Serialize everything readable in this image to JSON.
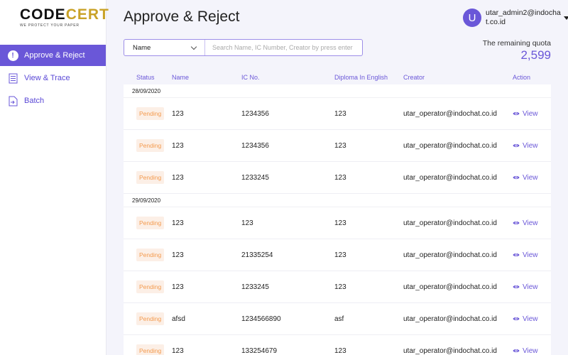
{
  "logo": {
    "code": "CODE",
    "cert": "CERT",
    "tagline": "WE PROTECT YOUR PAPER"
  },
  "sidebar": {
    "items": [
      {
        "label": "Approve & Reject",
        "icon": "alert-icon",
        "active": true
      },
      {
        "label": "View & Trace",
        "icon": "document-icon",
        "active": false
      },
      {
        "label": "Batch",
        "icon": "batch-icon",
        "active": false
      }
    ]
  },
  "header": {
    "title": "Approve & Reject",
    "user": {
      "initial": "U",
      "name": "utar_admin2@indochat.co.id"
    }
  },
  "search": {
    "field": "Name",
    "placeholder": "Search Name, IC Number, Creator by press enter"
  },
  "quota": {
    "label": "The remaining quota",
    "value": "2,599"
  },
  "table": {
    "headers": {
      "status": "Status",
      "name": "Name",
      "ic": "IC No.",
      "diploma": "Diploma In English",
      "creator": "Creator",
      "action": "Action"
    },
    "groups": [
      {
        "date": "28/09/2020",
        "rows": [
          {
            "status": "Pending",
            "name": "123",
            "ic": "1234356",
            "diploma": "123",
            "creator": "utar_operator@indochat.co.id",
            "action": "View"
          },
          {
            "status": "Pending",
            "name": "123",
            "ic": "1234356",
            "diploma": "123",
            "creator": "utar_operator@indochat.co.id",
            "action": "View"
          },
          {
            "status": "Pending",
            "name": "123",
            "ic": "1233245",
            "diploma": "123",
            "creator": "utar_operator@indochat.co.id",
            "action": "View"
          }
        ]
      },
      {
        "date": "29/09/2020",
        "rows": [
          {
            "status": "Pending",
            "name": "123",
            "ic": "123",
            "diploma": "123",
            "creator": "utar_operator@indochat.co.id",
            "action": "View"
          },
          {
            "status": "Pending",
            "name": "123",
            "ic": "21335254",
            "diploma": "123",
            "creator": "utar_operator@indochat.co.id",
            "action": "View"
          },
          {
            "status": "Pending",
            "name": "123",
            "ic": "1233245",
            "diploma": "123",
            "creator": "utar_operator@indochat.co.id",
            "action": "View"
          },
          {
            "status": "Pending",
            "name": "afsd",
            "ic": "1234566890",
            "diploma": "asf",
            "creator": "utar_operator@indochat.co.id",
            "action": "View"
          },
          {
            "status": "Pending",
            "name": "123",
            "ic": "133254679",
            "diploma": "123",
            "creator": "utar_operator@indochat.co.id",
            "action": "View"
          }
        ]
      }
    ]
  },
  "colors": {
    "accent": "#6a57d8",
    "pending_text": "#f39a4d",
    "pending_bg": "#fcefe6",
    "logo_gold": "#c9a227"
  }
}
